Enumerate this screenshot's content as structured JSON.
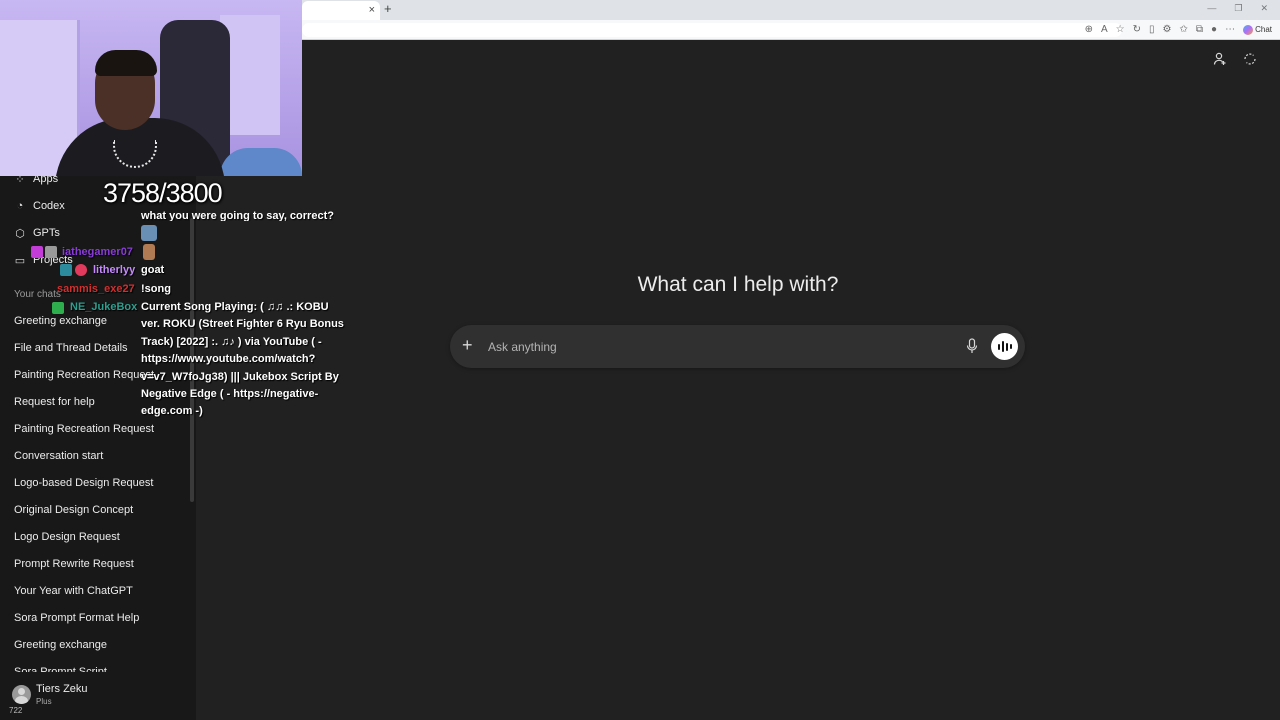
{
  "browser": {
    "tab_close": "×",
    "new_tab": "+",
    "chat_button": "Chat"
  },
  "sidebar": {
    "nav": [
      {
        "label": "Apps",
        "icon": "apps-icon"
      },
      {
        "label": "Codex",
        "icon": "codex-icon"
      },
      {
        "label": "GPTs",
        "icon": "gpts-icon"
      },
      {
        "label": "Projects",
        "icon": "folder-icon"
      }
    ],
    "section_label": "Your chats",
    "chats": [
      "Greeting exchange",
      "File and Thread Details",
      "Painting Recreation Request",
      "Request for help",
      "Painting Recreation Request",
      "Conversation start",
      "Logo-based Design Request",
      "Original Design Concept",
      "Logo Design Request",
      "Prompt Rewrite Request",
      "Your Year with ChatGPT",
      "Sora Prompt Format Help",
      "Greeting exchange",
      "Sora Prompt Script"
    ],
    "profile": {
      "name": "Tiers Zeku",
      "plan": "Plus",
      "badge": "722"
    }
  },
  "main": {
    "heading": "What can I help with?",
    "composer": {
      "placeholder": "Ask anything",
      "plus": "+"
    }
  },
  "overlay": {
    "counter": "3758/3800",
    "chat": {
      "partial_line": "what you were going to say, correct?",
      "users": [
        {
          "name": "iathegamer07",
          "color": "#8a3bd9"
        },
        {
          "name": "litherlyy",
          "color": "#c78bff"
        },
        {
          "name": "sammis_exe27",
          "color": "#d32f2f"
        },
        {
          "name": "NE_JukeBox",
          "color": "#2e9e8e"
        }
      ],
      "messages": [
        "goat",
        "!song"
      ],
      "song": "Current Song Playing: ( ♫♫ .: KOBU ver. ROKU (Street Fighter 6 Ryu Bonus Track) [2022] :. ♫♪ ) via YouTube ( - https://www.youtube.com/watch?v=v7_W7foJg38) ||| Jukebox Script By Negative Edge ( - https://negative-edge.com -)"
    }
  }
}
